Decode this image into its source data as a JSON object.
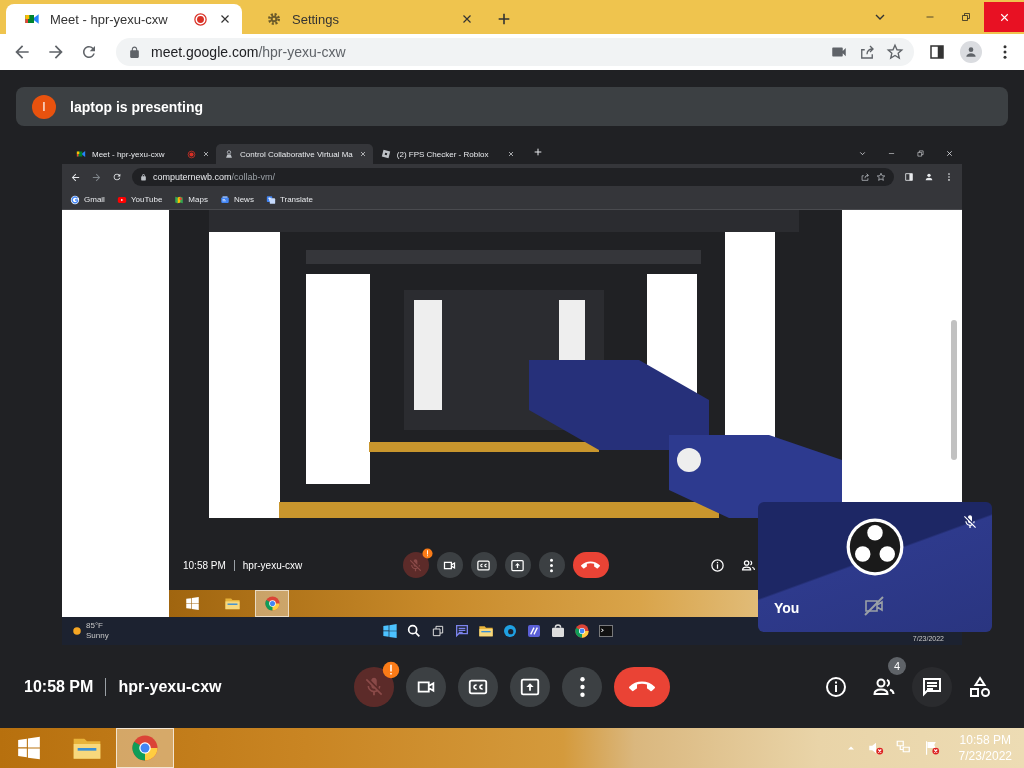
{
  "browser": {
    "tabs": [
      {
        "title": "Meet - hpr-yexu-cxw",
        "selected": true,
        "recording": true
      },
      {
        "title": "Settings",
        "selected": false,
        "recording": false
      }
    ],
    "url": {
      "host": "meet.google.com",
      "path": "/hpr-yexu-cxw"
    }
  },
  "banner": {
    "initial": "l",
    "text": "laptop is presenting"
  },
  "presentation": {
    "browser": {
      "tabs": [
        {
          "title": "Meet - hpr-yexu-cxw",
          "selected": false,
          "recording": true
        },
        {
          "title": "Control Collaborative Virtual Ma",
          "selected": true,
          "recording": false
        },
        {
          "title": "(2) FPS Checker - Roblox",
          "selected": false,
          "recording": false
        }
      ],
      "url": {
        "host": "computernewb.com",
        "path": "/collab-vm/"
      },
      "bookmarks": [
        "Gmail",
        "YouTube",
        "Maps",
        "News",
        "Translate"
      ]
    },
    "meeting_bar": {
      "time": "10:58 PM",
      "code": "hpr-yexu-cxw",
      "mic_muted": true
    },
    "weather": {
      "temperature": "85°F",
      "condition": "Sunny"
    },
    "date": "7/23/2022",
    "self_tile": {
      "name": "You",
      "mic_muted": true,
      "camera_off": true
    }
  },
  "meeting_bar": {
    "time": "10:58 PM",
    "code": "hpr-yexu-cxw",
    "mic_muted": true,
    "participants": "4"
  },
  "taskbar": {
    "time": "10:58 PM",
    "date": "7/23/2022"
  }
}
